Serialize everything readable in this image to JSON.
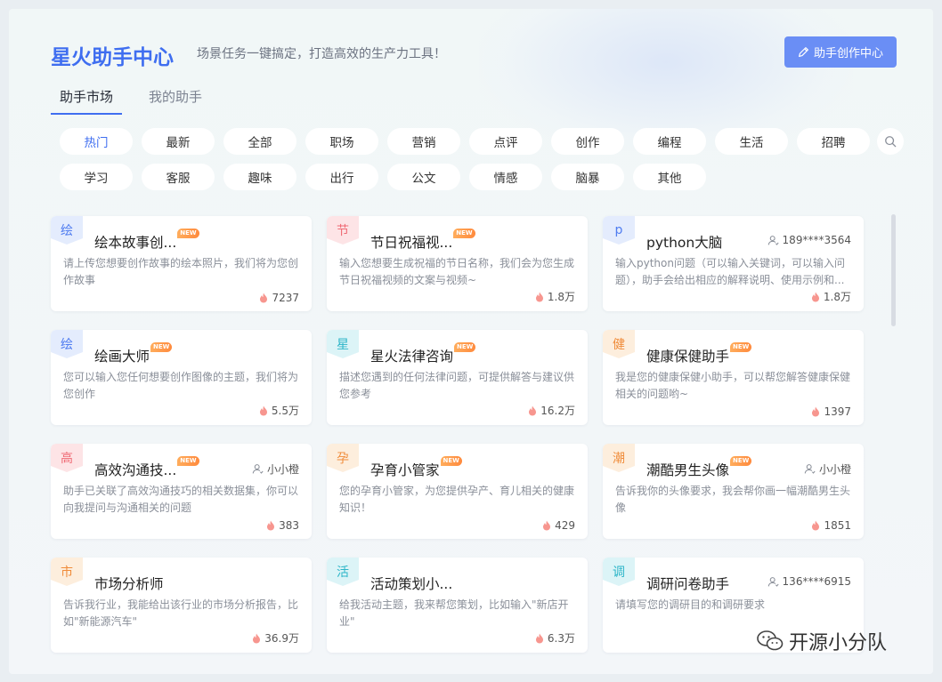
{
  "header": {
    "title": "星火助手中心",
    "subtitle": "场景任务一键搞定，打造高效的生产力工具！",
    "create_button": "助手创作中心"
  },
  "tabs": [
    {
      "label": "助手市场",
      "active": true
    },
    {
      "label": "我的助手",
      "active": false
    }
  ],
  "filters": {
    "row1": [
      "热门",
      "最新",
      "全部",
      "职场",
      "营销",
      "点评",
      "创作",
      "编程",
      "生活",
      "招聘"
    ],
    "row2": [
      "学习",
      "客服",
      "趣味",
      "出行",
      "公文",
      "情感",
      "脑暴",
      "其他"
    ],
    "active": "热门"
  },
  "cards": [
    {
      "badge": "绘",
      "badge_bg": "#e4ecfd",
      "badge_color": "#4f7cf0",
      "name": "绘本故事创...",
      "is_new": true,
      "author": "",
      "desc": "请上传您想要创作故事的绘本照片，我们将为您创作故事",
      "heat": "7237"
    },
    {
      "badge": "节",
      "badge_bg": "#fde4e6",
      "badge_color": "#ef6a74",
      "name": "节日祝福视...",
      "is_new": true,
      "author": "",
      "desc": "输入您想要生成祝福的节日名称，我们会为您生成节日祝福视频的文案与视频~",
      "heat": "1.8万"
    },
    {
      "badge": "p",
      "badge_bg": "#e4ecfd",
      "badge_color": "#4f7cf0",
      "name": "python大脑",
      "is_new": false,
      "author": "189****3564",
      "desc": "输入python问题（可以输入关键词，可以输入问题），助手会给出相应的解释说明、使用示例和...",
      "heat": "1.8万"
    },
    {
      "badge": "绘",
      "badge_bg": "#e4ecfd",
      "badge_color": "#4f7cf0",
      "name": "绘画大师",
      "is_new": true,
      "author": "",
      "desc": "您可以输入您任何想要创作图像的主题，我们将为您创作",
      "heat": "5.5万"
    },
    {
      "badge": "星",
      "badge_bg": "#dcf4f7",
      "badge_color": "#2cb5c8",
      "name": "星火法律咨询",
      "is_new": true,
      "author": "",
      "desc": "描述您遇到的任何法律问题，可提供解答与建议供您参考",
      "heat": "16.2万"
    },
    {
      "badge": "健",
      "badge_bg": "#fdeedd",
      "badge_color": "#f08c3a",
      "name": "健康保健助手",
      "is_new": true,
      "author": "",
      "desc": "我是您的健康保健小助手，可以帮您解答健康保健相关的问题哟~",
      "heat": "1397"
    },
    {
      "badge": "高",
      "badge_bg": "#fde4e6",
      "badge_color": "#ef6a74",
      "name": "高效沟通技...",
      "is_new": true,
      "author": "小小橙",
      "desc": "助手已关联了高效沟通技巧的相关数据集，你可以向我提问与沟通相关的问题",
      "heat": "383"
    },
    {
      "badge": "孕",
      "badge_bg": "#fdeedd",
      "badge_color": "#f08c3a",
      "name": "孕育小管家",
      "is_new": true,
      "author": "",
      "desc": "您的孕育小管家，为您提供孕产、育儿相关的健康知识！",
      "heat": "429"
    },
    {
      "badge": "潮",
      "badge_bg": "#fdeedd",
      "badge_color": "#f08c3a",
      "name": "潮酷男生头像",
      "is_new": true,
      "author": "小小橙",
      "desc": "告诉我你的头像要求，我会帮你画一幅潮酷男生头像",
      "heat": "1851"
    },
    {
      "badge": "市",
      "badge_bg": "#fdeedd",
      "badge_color": "#f08c3a",
      "name": "市场分析师",
      "is_new": false,
      "author": "",
      "desc": "告诉我行业，我能给出该行业的市场分析报告，比如\"新能源汽车\"",
      "heat": "36.9万"
    },
    {
      "badge": "活",
      "badge_bg": "#dcf4f7",
      "badge_color": "#2cb5c8",
      "name": "活动策划小...",
      "is_new": false,
      "author": "",
      "desc": "给我活动主题，我来帮您策划，比如输入\"新店开业\"",
      "heat": "6.3万"
    },
    {
      "badge": "调",
      "badge_bg": "#dcf4f7",
      "badge_color": "#2cb5c8",
      "name": "调研问卷助手",
      "is_new": false,
      "author": "136****6915",
      "desc": "请填写您的调研目的和调研要求",
      "heat": ""
    }
  ],
  "new_tag_text": "NEW",
  "watermark_account": "开源小分队",
  "colors": {
    "accent": "#3f6ef0",
    "button": "#6a8ef5",
    "heat_icon": "#f7968f"
  },
  "icons": {
    "edit": "pencil-icon",
    "search": "search-icon",
    "author": "user-icon",
    "heat": "flame-icon",
    "wechat": "wechat-icon"
  }
}
